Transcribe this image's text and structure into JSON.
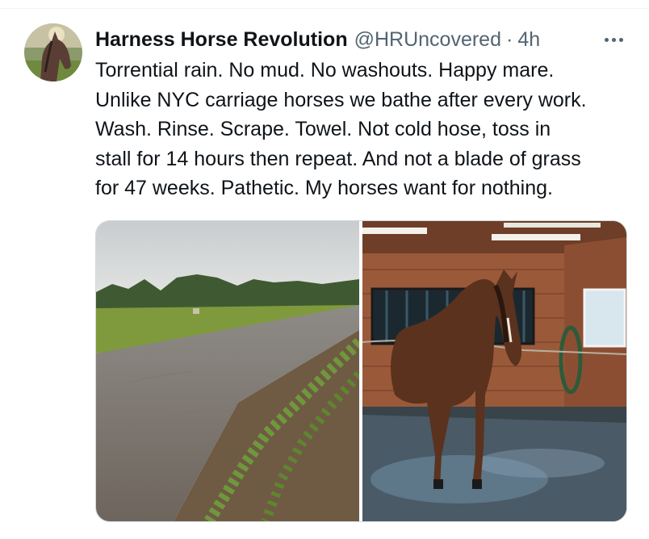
{
  "tweet": {
    "display_name": "Harness Horse Revolution",
    "handle": "@HRUncovered",
    "separator": "·",
    "time": "4h",
    "text_lines": [
      "Torrential rain. No mud. No washouts. Happy mare.",
      "Unlike NYC carriage horses we bathe after every work.",
      "Wash. Rinse. Scrape. Towel. Not cold hose, toss in",
      "stall for 14 hours then repeat. And not a blade of grass",
      "for 47 weeks. Pathetic. My horses want for nothing."
    ],
    "avatar_icon": "horse-avatar-icon",
    "more_icon": "more-options-icon",
    "media": [
      {
        "name": "track-photo",
        "description_icon": "dirt-track-image"
      },
      {
        "name": "wash-stall-photo",
        "description_icon": "horse-in-wash-stall-image"
      }
    ]
  }
}
